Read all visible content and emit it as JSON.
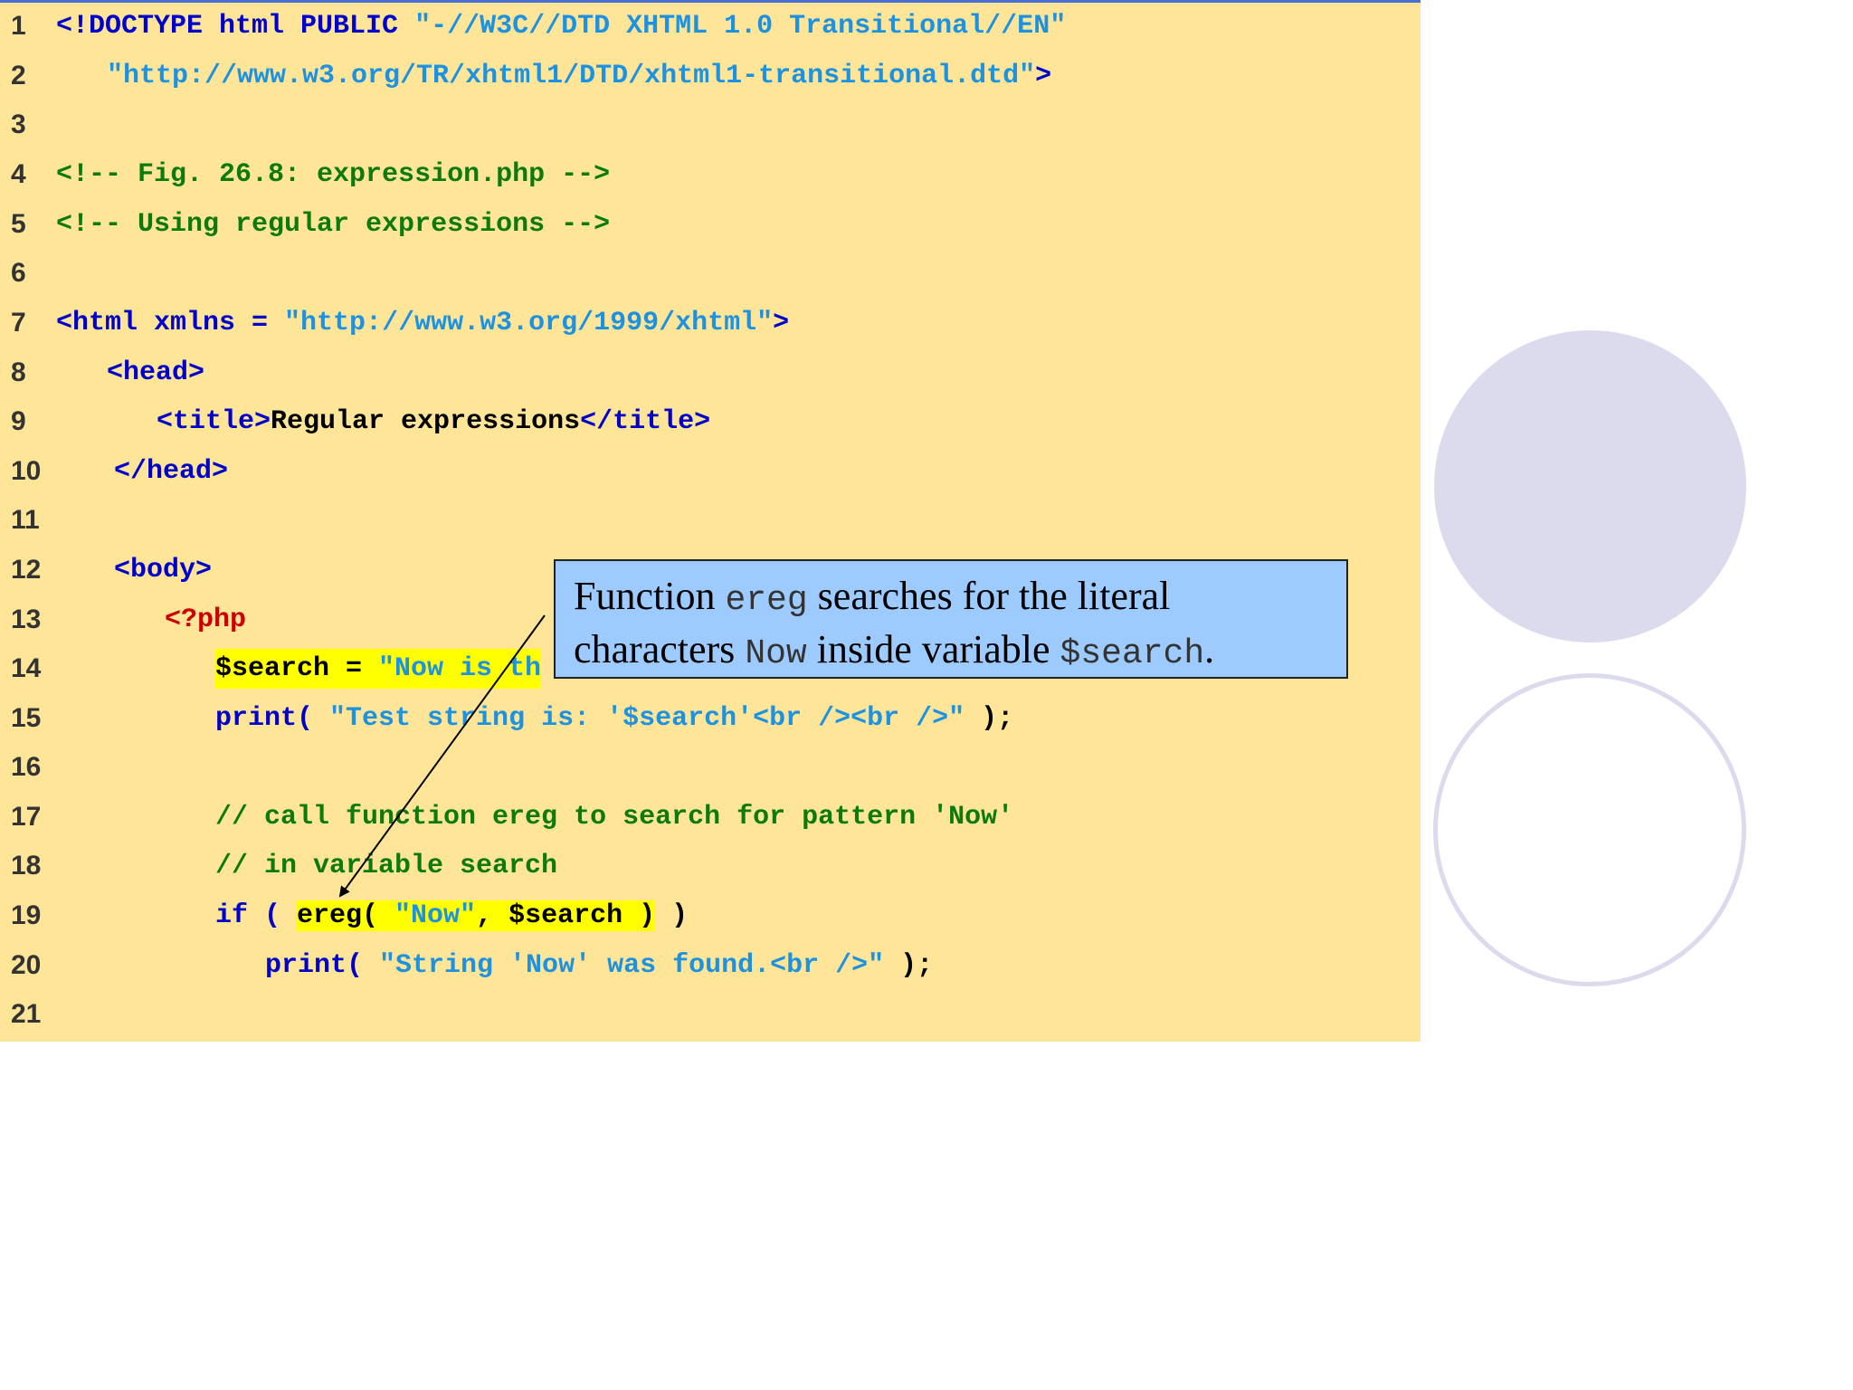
{
  "colors": {
    "panel_bg": "#ffe598",
    "callout_bg": "#9ecbff",
    "keyword_blue": "#0000cc",
    "string_blue": "#1d92e0",
    "comment_green": "#0d7a0d",
    "php_red": "#cc0000",
    "highlight_yellow": "#ffff00",
    "circle_lavender": "#dcdbee"
  },
  "code": {
    "line_numbers": [
      "1",
      "2",
      "3",
      "4",
      "5",
      "6",
      "7",
      "8",
      "9",
      "10",
      "11",
      "12",
      "13",
      "14",
      "15",
      "16",
      "17",
      "18",
      "19",
      "20",
      "21"
    ],
    "l1": {
      "a": "<!DOCTYPE html PUBLIC ",
      "b": "\"-//W3C//DTD XHTML 1.0 Transitional//EN\""
    },
    "l2": {
      "a": "\"http://www.w3.org/TR/xhtml1/DTD/xhtml1-transitional.dtd\"",
      "b": ">"
    },
    "l4": "<!-- Fig. 26.8: expression.php -->",
    "l5": "<!-- Using regular expressions -->",
    "l7": {
      "a": "<html xmlns = ",
      "b": "\"http://www.w3.org/1999/xhtml\"",
      "c": ">"
    },
    "l8": "<head>",
    "l9": {
      "a": "<title>",
      "b": "Regular expressions",
      "c": "</title>"
    },
    "l10": "</head>",
    "l12": "<body>",
    "l13": "<?php",
    "l14": {
      "a": "$search = ",
      "b": "\"Now is th"
    },
    "l15": {
      "a": "print( ",
      "b": "\"Test string is: '$search'<br /><br />\"",
      "c": " );"
    },
    "l17": "// call function ereg to search for pattern 'Now'",
    "l18": "// in variable search",
    "l19": {
      "a": "if ( ",
      "b": "ereg( ",
      "c": "\"Now\"",
      "d": ", $search )",
      "e": " )"
    },
    "l20": {
      "a": "print( ",
      "b": "\"String 'Now' was found.<br />\"",
      "c": " );"
    }
  },
  "callout": {
    "t1": "Function ",
    "code1": "ereg",
    "t2": " searches for the literal characters ",
    "code2": "Now",
    "t3": " inside variable ",
    "code3": "$search",
    "t4": "."
  }
}
